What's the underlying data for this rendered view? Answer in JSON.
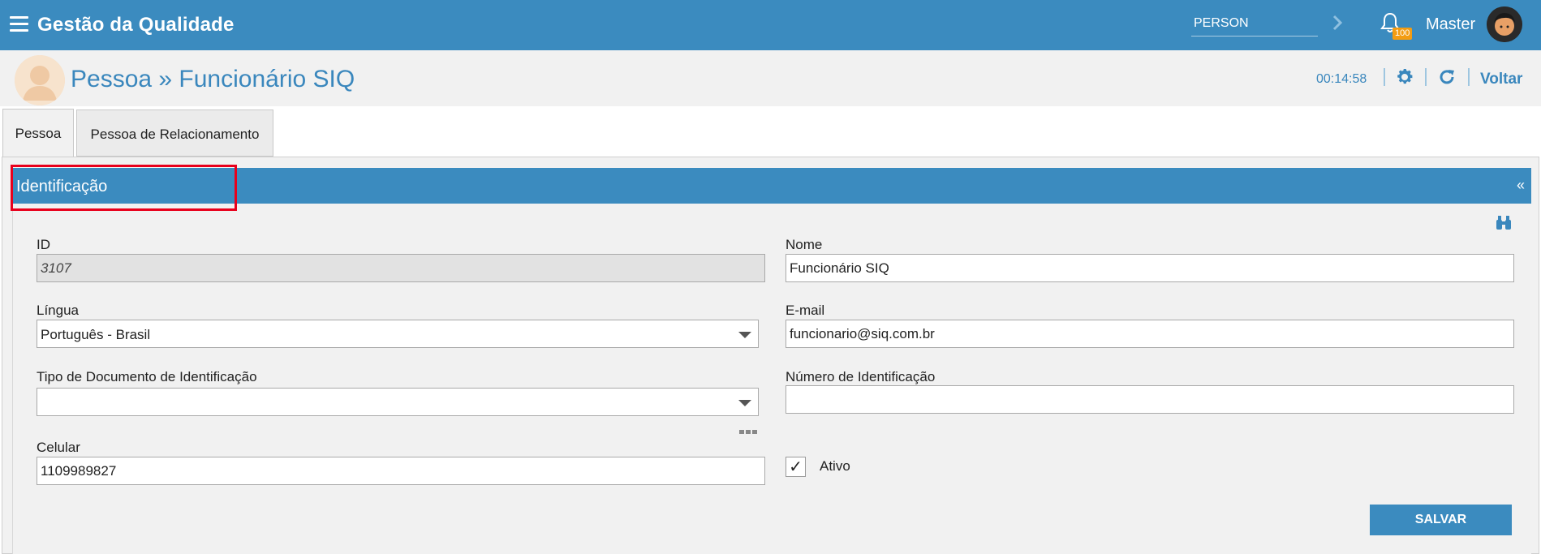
{
  "app": {
    "title": "Gestão da Qualidade"
  },
  "topbar": {
    "search_value": "PERSON",
    "notification_count": "100",
    "username": "Master"
  },
  "header": {
    "title": "Pessoa » Funcionário SIQ",
    "timer": "00:14:58",
    "back_label": "Voltar"
  },
  "tabs": [
    {
      "label": "Pessoa",
      "active": true
    },
    {
      "label": "Pessoa de Relacionamento",
      "active": false
    }
  ],
  "section": {
    "title": "Identificação",
    "collapse_glyph": "«"
  },
  "form": {
    "id": {
      "label": "ID",
      "value": "3107"
    },
    "nome": {
      "label": "Nome",
      "value": "Funcionário SIQ"
    },
    "lingua": {
      "label": "Língua",
      "value": "Português - Brasil"
    },
    "email": {
      "label": "E-mail",
      "value": "funcionario@siq.com.br"
    },
    "tipo_documento": {
      "label": "Tipo de Documento de Identificação",
      "value": ""
    },
    "numero_identificacao": {
      "label": "Número de Identificação",
      "value": ""
    },
    "celular": {
      "label": "Celular",
      "value": "1109989827"
    },
    "ativo": {
      "label": "Ativo",
      "checked": true,
      "check_glyph": "✓"
    },
    "save_label": "SALVAR"
  },
  "colors": {
    "primary": "#3b8bbf",
    "title_blue": "#3a87bd",
    "highlight_red": "#e8001c",
    "badge_orange": "#f39c12"
  },
  "icons": [
    "menu-icon",
    "chevron-right-icon",
    "bell-icon",
    "user-avatar",
    "person-avatar",
    "gear-icon",
    "refresh-icon",
    "collapse-icon",
    "binoculars-icon",
    "more-options-icon",
    "dropdown-arrow-icon"
  ]
}
